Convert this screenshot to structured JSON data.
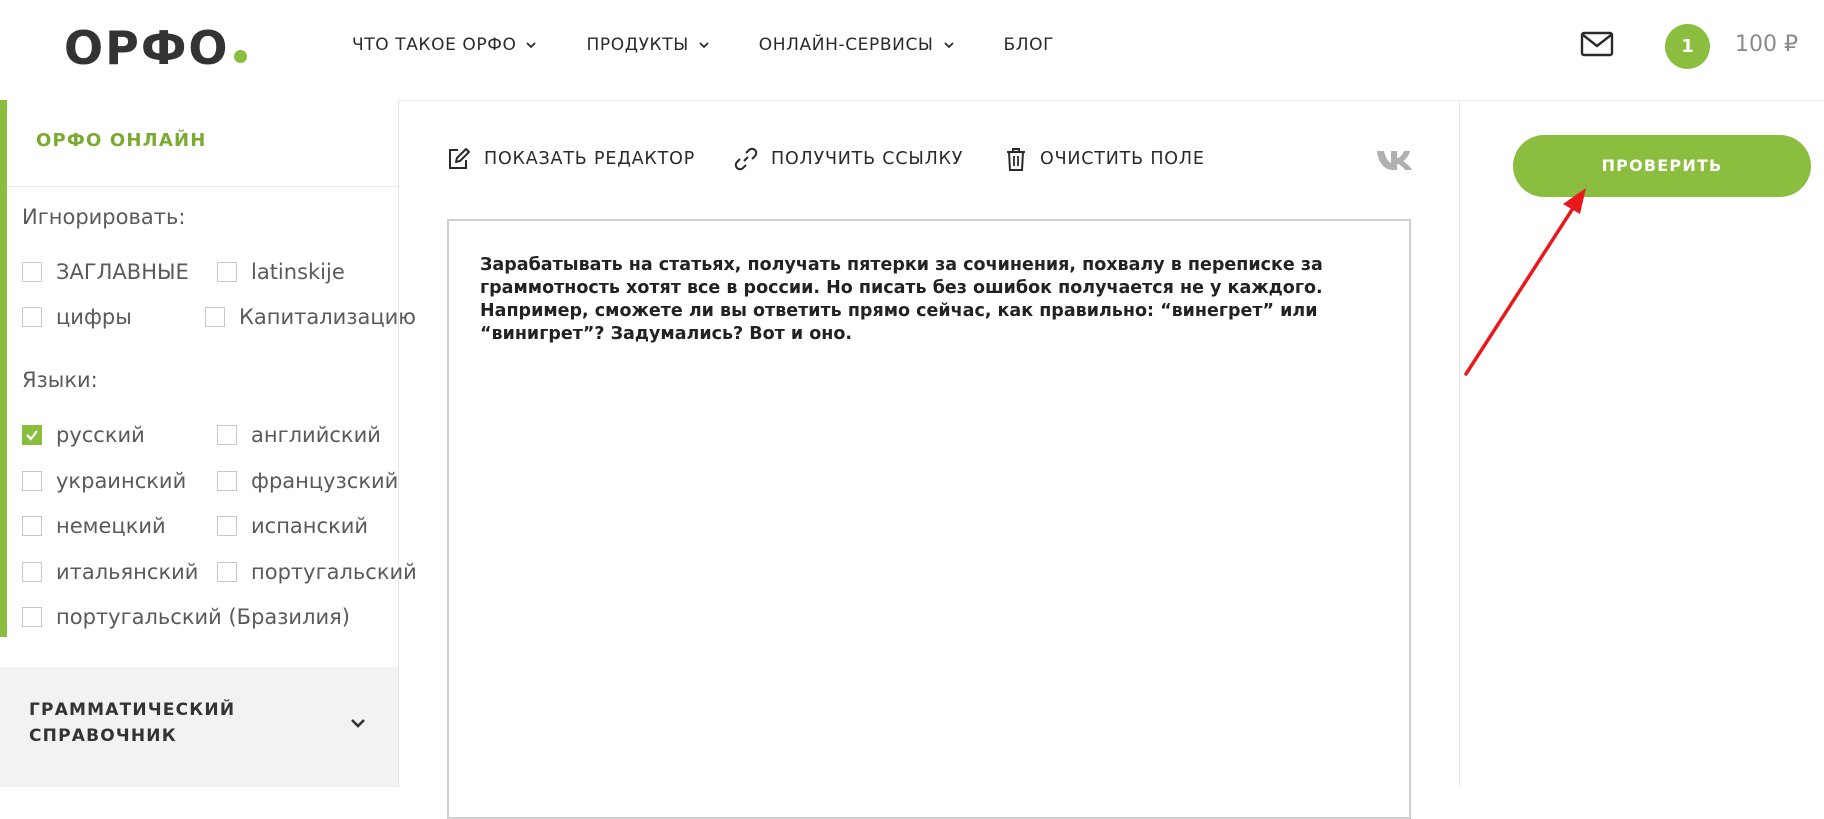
{
  "header": {
    "logo_text": "ОРФО",
    "nav": [
      {
        "label": "ЧТО ТАКОЕ ОРФО",
        "has_dropdown": true
      },
      {
        "label": "ПРОДУКТЫ",
        "has_dropdown": true
      },
      {
        "label": "ОНЛАЙН-СЕРВИСЫ",
        "has_dropdown": true
      },
      {
        "label": "БЛОГ",
        "has_dropdown": false
      }
    ],
    "mail_icon": "envelope-icon",
    "notification_count": "1",
    "balance": "100 ₽"
  },
  "sidebar": {
    "title": "ОРФО ОНЛАЙН",
    "ignore_label": "Игнорировать:",
    "ignore_options": [
      {
        "label": "ЗАГЛАВНЫЕ",
        "checked": false
      },
      {
        "label": "latinskije",
        "checked": false
      },
      {
        "label": "цифры",
        "checked": false
      },
      {
        "label": "Капитализацию",
        "checked": false
      }
    ],
    "languages_label": "Языки:",
    "languages": [
      {
        "label": "русский",
        "checked": true
      },
      {
        "label": "английский",
        "checked": false
      },
      {
        "label": "украинский",
        "checked": false
      },
      {
        "label": "французский",
        "checked": false
      },
      {
        "label": "немецкий",
        "checked": false
      },
      {
        "label": "испанский",
        "checked": false
      },
      {
        "label": "итальянский",
        "checked": false
      },
      {
        "label": "португальский",
        "checked": false
      },
      {
        "label": "португальский (Бразилия)",
        "checked": false
      }
    ],
    "accordion_title": "ГРАММАТИЧЕСКИЙ СПРАВОЧНИК"
  },
  "toolbar": {
    "show_editor": "ПОКАЗАТЬ РЕДАКТОР",
    "get_link": "ПОЛУЧИТЬ ССЫЛКУ",
    "clear_field": "ОЧИСТИТЬ ПОЛЕ",
    "share_icon": "vk-icon"
  },
  "editor": {
    "text": "Зарабатывать на статьях, получать пятерки за сочинения, похвалу в переписке за граммотность хотят все в россии. Но писать без ошибок получается не у каждого. Например, сможете ли вы ответить прямо сейчас, как правильно: “винегрет” или “винигрет”? Задумались? Вот и оно."
  },
  "actions": {
    "check_button": "ПРОВЕРИТЬ"
  },
  "colors": {
    "accent": "#8bbe3f",
    "annotation_arrow": "#e8191d"
  }
}
